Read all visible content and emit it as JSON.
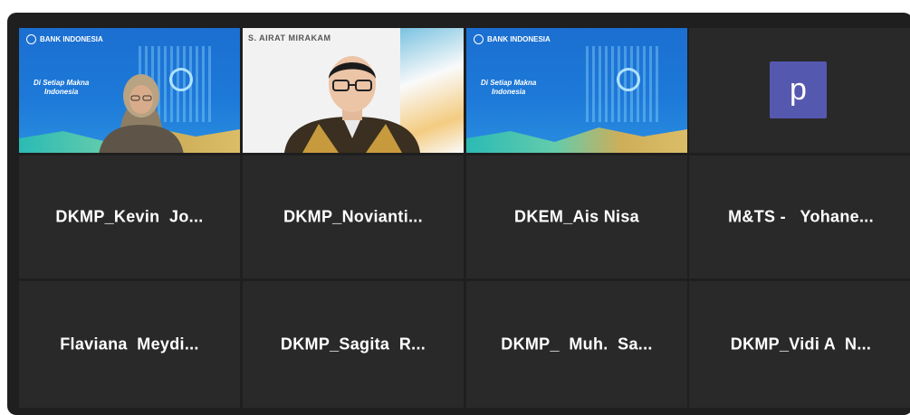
{
  "video_tiles": {
    "tile1": {
      "logo": "BANK INDONESIA",
      "tagline_line1": "Di Setiap Makna",
      "tagline_line2": "Indonesia"
    },
    "tile2": {
      "logo": "S. AIRAT MIRAKAM"
    },
    "tile3": {
      "logo": "BANK INDONESIA",
      "tagline_line1": "Di Setiap Makna",
      "tagline_line2": "Indonesia"
    },
    "tile4": {
      "avatar_letter": "p"
    }
  },
  "participants_row2": [
    "DKMP_Kevin  Jo...",
    "DKMP_Novianti...",
    "DKEM_Ais Nisa",
    "M&TS -   Yohane..."
  ],
  "participants_row3": [
    "Flaviana  Meydi...",
    "DKMP_Sagita  R...",
    "DKMP_  Muh.  Sa...",
    "DKMP_Vidi A  N..."
  ],
  "colors": {
    "background": "#1f1f1f",
    "tile": "#292929",
    "active_speaker_border": "#c9d65a",
    "avatar": "#5558af"
  }
}
